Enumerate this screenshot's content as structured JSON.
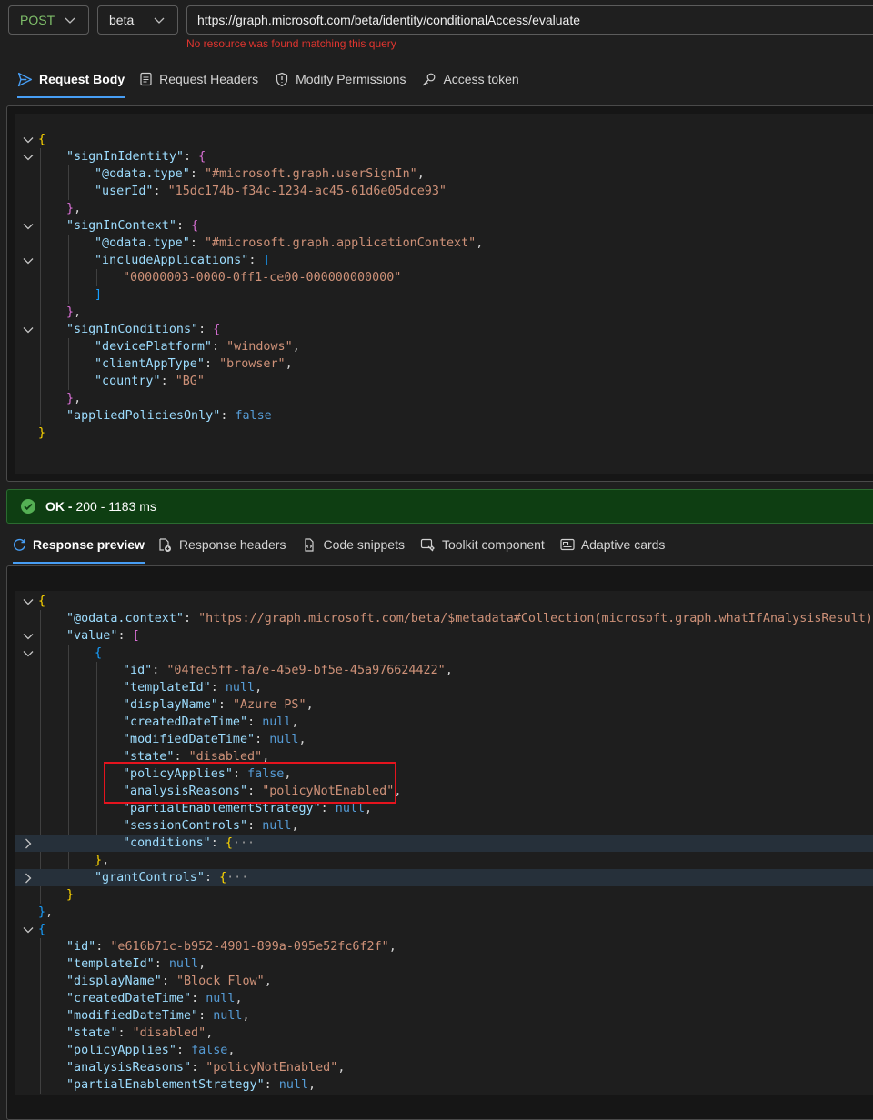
{
  "request": {
    "method": "POST",
    "version": "beta",
    "url": "https://graph.microsoft.com/beta/identity/conditionalAccess/evaluate",
    "url_error": "No resource was found matching this query"
  },
  "request_tabs": [
    {
      "label": "Request Body",
      "icon": "send-icon",
      "active": true
    },
    {
      "label": "Request Headers",
      "icon": "document-icon",
      "active": false
    },
    {
      "label": "Modify Permissions",
      "icon": "shield-icon",
      "active": false
    },
    {
      "label": "Access token",
      "icon": "key-icon",
      "active": false
    }
  ],
  "status": {
    "ok": "OK -",
    "detail": "200 - 1183 ms",
    "color": "#0e3e12",
    "icon": "check-circle-icon"
  },
  "response_tabs": [
    {
      "label": "Response preview",
      "icon": "preview-icon",
      "active": true
    },
    {
      "label": "Response headers",
      "icon": "headers-icon",
      "active": false
    },
    {
      "label": "Code snippets",
      "icon": "code-snippet-icon",
      "active": false
    },
    {
      "label": "Toolkit component",
      "icon": "toolkit-icon",
      "active": false
    },
    {
      "label": "Adaptive cards",
      "icon": "card-icon",
      "active": false
    }
  ],
  "request_body": [
    {
      "fold": "open",
      "t": [
        [
          "b1",
          "{"
        ]
      ]
    },
    {
      "fold": "open",
      "t": [
        [
          "k",
          "\"signInIdentity\""
        ],
        [
          "p",
          ": "
        ],
        [
          "b2",
          "{"
        ]
      ]
    },
    {
      "t": [
        [
          "k",
          "\"@odata.type\""
        ],
        [
          "p",
          ": "
        ],
        [
          "s",
          "\"#microsoft.graph.userSignIn\""
        ],
        [
          "p",
          ","
        ]
      ]
    },
    {
      "t": [
        [
          "k",
          "\"userId\""
        ],
        [
          "p",
          ": "
        ],
        [
          "s",
          "\"15dc174b-f34c-1234-ac45-61d6e05dce93\""
        ]
      ]
    },
    {
      "t": [
        [
          "b2",
          "}"
        ],
        [
          "p",
          ","
        ]
      ]
    },
    {
      "fold": "open",
      "t": [
        [
          "k",
          "\"signInContext\""
        ],
        [
          "p",
          ": "
        ],
        [
          "b2",
          "{"
        ]
      ]
    },
    {
      "t": [
        [
          "k",
          "\"@odata.type\""
        ],
        [
          "p",
          ": "
        ],
        [
          "s",
          "\"#microsoft.graph.applicationContext\""
        ],
        [
          "p",
          ","
        ]
      ]
    },
    {
      "fold": "open",
      "t": [
        [
          "k",
          "\"includeApplications\""
        ],
        [
          "p",
          ": "
        ],
        [
          "b3",
          "["
        ]
      ]
    },
    {
      "t": [
        [
          "s",
          "\"00000003-0000-0ff1-ce00-000000000000\""
        ]
      ]
    },
    {
      "t": [
        [
          "b3",
          "]"
        ]
      ]
    },
    {
      "t": [
        [
          "b2",
          "}"
        ],
        [
          "p",
          ","
        ]
      ]
    },
    {
      "fold": "open",
      "t": [
        [
          "k",
          "\"signInConditions\""
        ],
        [
          "p",
          ": "
        ],
        [
          "b2",
          "{"
        ]
      ]
    },
    {
      "t": [
        [
          "k",
          "\"devicePlatform\""
        ],
        [
          "p",
          ": "
        ],
        [
          "s",
          "\"windows\""
        ],
        [
          "p",
          ","
        ]
      ]
    },
    {
      "t": [
        [
          "k",
          "\"clientAppType\""
        ],
        [
          "p",
          ": "
        ],
        [
          "s",
          "\"browser\""
        ],
        [
          "p",
          ","
        ]
      ]
    },
    {
      "t": [
        [
          "k",
          "\"country\""
        ],
        [
          "p",
          ": "
        ],
        [
          "s",
          "\"BG\""
        ]
      ]
    },
    {
      "t": [
        [
          "b2",
          "}"
        ],
        [
          "p",
          ","
        ]
      ]
    },
    {
      "t": [
        [
          "k",
          "\"appliedPoliciesOnly\""
        ],
        [
          "p",
          ": "
        ],
        [
          "n",
          "false"
        ]
      ]
    },
    {
      "t": [
        [
          "b1",
          "}"
        ]
      ]
    }
  ],
  "response_body": [
    {
      "fold": "open",
      "t": [
        [
          "b1",
          "{"
        ]
      ]
    },
    {
      "t": [
        [
          "k",
          "\"@odata.context\""
        ],
        [
          "p",
          ": "
        ],
        [
          "s",
          "\"https://graph.microsoft.com/beta/$metadata#Collection(microsoft.graph.whatIfAnalysisResult)\""
        ],
        [
          "p",
          ","
        ]
      ]
    },
    {
      "fold": "open",
      "t": [
        [
          "k",
          "\"value\""
        ],
        [
          "p",
          ": "
        ],
        [
          "b2",
          "["
        ]
      ]
    },
    {
      "fold": "open",
      "t": [
        [
          "b3",
          "{"
        ]
      ]
    },
    {
      "t": [
        [
          "k",
          "\"id\""
        ],
        [
          "p",
          ": "
        ],
        [
          "s",
          "\"04fec5ff-fa7e-45e9-bf5e-45a976624422\""
        ],
        [
          "p",
          ","
        ]
      ]
    },
    {
      "t": [
        [
          "k",
          "\"templateId\""
        ],
        [
          "p",
          ": "
        ],
        [
          "n",
          "null"
        ],
        [
          "p",
          ","
        ]
      ]
    },
    {
      "t": [
        [
          "k",
          "\"displayName\""
        ],
        [
          "p",
          ": "
        ],
        [
          "s",
          "\"Azure PS\""
        ],
        [
          "p",
          ","
        ]
      ]
    },
    {
      "t": [
        [
          "k",
          "\"createdDateTime\""
        ],
        [
          "p",
          ": "
        ],
        [
          "n",
          "null"
        ],
        [
          "p",
          ","
        ]
      ]
    },
    {
      "t": [
        [
          "k",
          "\"modifiedDateTime\""
        ],
        [
          "p",
          ": "
        ],
        [
          "n",
          "null"
        ],
        [
          "p",
          ","
        ]
      ]
    },
    {
      "t": [
        [
          "k",
          "\"state\""
        ],
        [
          "p",
          ": "
        ],
        [
          "s",
          "\"disabled\""
        ],
        [
          "p",
          ","
        ]
      ]
    },
    {
      "t": [
        [
          "k",
          "\"policyApplies\""
        ],
        [
          "p",
          ": "
        ],
        [
          "n",
          "false"
        ],
        [
          "p",
          ","
        ]
      ]
    },
    {
      "t": [
        [
          "k",
          "\"analysisReasons\""
        ],
        [
          "p",
          ": "
        ],
        [
          "s",
          "\"policyNotEnabled\""
        ],
        [
          "p",
          ","
        ]
      ]
    },
    {
      "t": [
        [
          "k",
          "\"partialEnablementStrategy\""
        ],
        [
          "p",
          ": "
        ],
        [
          "n",
          "null"
        ],
        [
          "p",
          ","
        ]
      ]
    },
    {
      "t": [
        [
          "k",
          "\"sessionControls\""
        ],
        [
          "p",
          ": "
        ],
        [
          "n",
          "null"
        ],
        [
          "p",
          ","
        ]
      ]
    },
    {
      "fold": "closed",
      "hl": true,
      "t": [
        [
          "k",
          "\"conditions\""
        ],
        [
          "p",
          ": "
        ],
        [
          "b1",
          "{"
        ],
        [
          "dots",
          "···"
        ]
      ]
    },
    {
      "t": [
        [
          "b1",
          "}"
        ],
        [
          "p",
          ","
        ]
      ]
    },
    {
      "fold": "closed",
      "hl": true,
      "t": [
        [
          "k",
          "\"grantControls\""
        ],
        [
          "p",
          ": "
        ],
        [
          "b1",
          "{"
        ],
        [
          "dots",
          "···"
        ]
      ]
    },
    {
      "t": [
        [
          "b1",
          "}"
        ]
      ]
    },
    {
      "t": [
        [
          "b3",
          "}"
        ],
        [
          "p",
          ","
        ]
      ]
    },
    {
      "fold": "open",
      "t": [
        [
          "b3",
          "{"
        ]
      ]
    },
    {
      "t": [
        [
          "k",
          "\"id\""
        ],
        [
          "p",
          ": "
        ],
        [
          "s",
          "\"e616b71c-b952-4901-899a-095e52fc6f2f\""
        ],
        [
          "p",
          ","
        ]
      ]
    },
    {
      "t": [
        [
          "k",
          "\"templateId\""
        ],
        [
          "p",
          ": "
        ],
        [
          "n",
          "null"
        ],
        [
          "p",
          ","
        ]
      ]
    },
    {
      "t": [
        [
          "k",
          "\"displayName\""
        ],
        [
          "p",
          ": "
        ],
        [
          "s",
          "\"Block Flow\""
        ],
        [
          "p",
          ","
        ]
      ]
    },
    {
      "t": [
        [
          "k",
          "\"createdDateTime\""
        ],
        [
          "p",
          ": "
        ],
        [
          "n",
          "null"
        ],
        [
          "p",
          ","
        ]
      ]
    },
    {
      "t": [
        [
          "k",
          "\"modifiedDateTime\""
        ],
        [
          "p",
          ": "
        ],
        [
          "n",
          "null"
        ],
        [
          "p",
          ","
        ]
      ]
    },
    {
      "t": [
        [
          "k",
          "\"state\""
        ],
        [
          "p",
          ": "
        ],
        [
          "s",
          "\"disabled\""
        ],
        [
          "p",
          ","
        ]
      ]
    },
    {
      "t": [
        [
          "k",
          "\"policyApplies\""
        ],
        [
          "p",
          ": "
        ],
        [
          "n",
          "false"
        ],
        [
          "p",
          ","
        ]
      ]
    },
    {
      "t": [
        [
          "k",
          "\"analysisReasons\""
        ],
        [
          "p",
          ": "
        ],
        [
          "s",
          "\"policyNotEnabled\""
        ],
        [
          "p",
          ","
        ]
      ]
    },
    {
      "t": [
        [
          "k",
          "\"partialEnablementStrategy\""
        ],
        [
          "p",
          ": "
        ],
        [
          "n",
          "null"
        ],
        [
          "p",
          ","
        ]
      ]
    }
  ]
}
